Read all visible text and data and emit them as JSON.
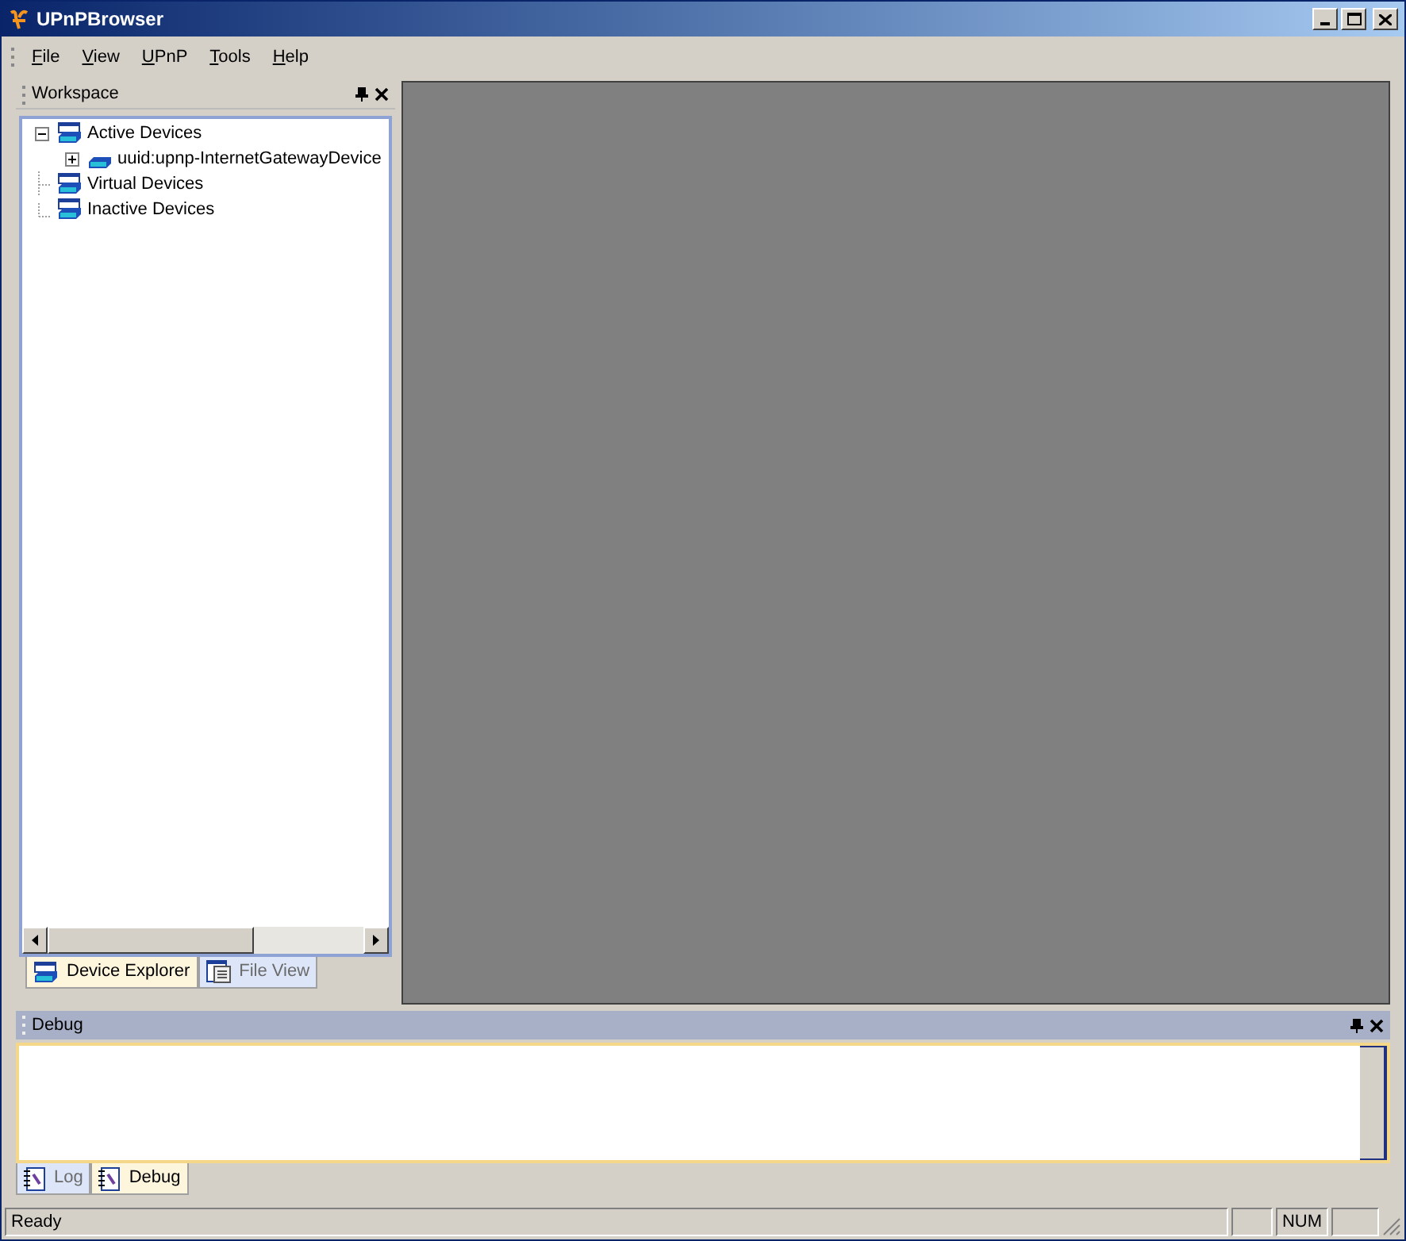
{
  "window": {
    "title": "UPnPBrowser"
  },
  "menu": [
    {
      "label": "File"
    },
    {
      "label": "View"
    },
    {
      "label": "UPnP"
    },
    {
      "label": "Tools"
    },
    {
      "label": "Help"
    }
  ],
  "workspace": {
    "title": "Workspace",
    "tree": [
      {
        "label": "Active Devices",
        "expanded": true,
        "children": [
          {
            "label": "uuid:upnp-InternetGatewayDevice",
            "expanded": false
          }
        ]
      },
      {
        "label": "Virtual Devices"
      },
      {
        "label": "Inactive Devices"
      }
    ],
    "tabs": [
      {
        "label": "Device Explorer",
        "selected": true
      },
      {
        "label": "File View",
        "selected": false
      }
    ]
  },
  "debug": {
    "title": "Debug",
    "tabs": [
      {
        "label": "Log",
        "selected": false
      },
      {
        "label": "Debug",
        "selected": true
      }
    ]
  },
  "status_bar": {
    "text": "Ready",
    "indicators": [
      "NUM"
    ]
  }
}
